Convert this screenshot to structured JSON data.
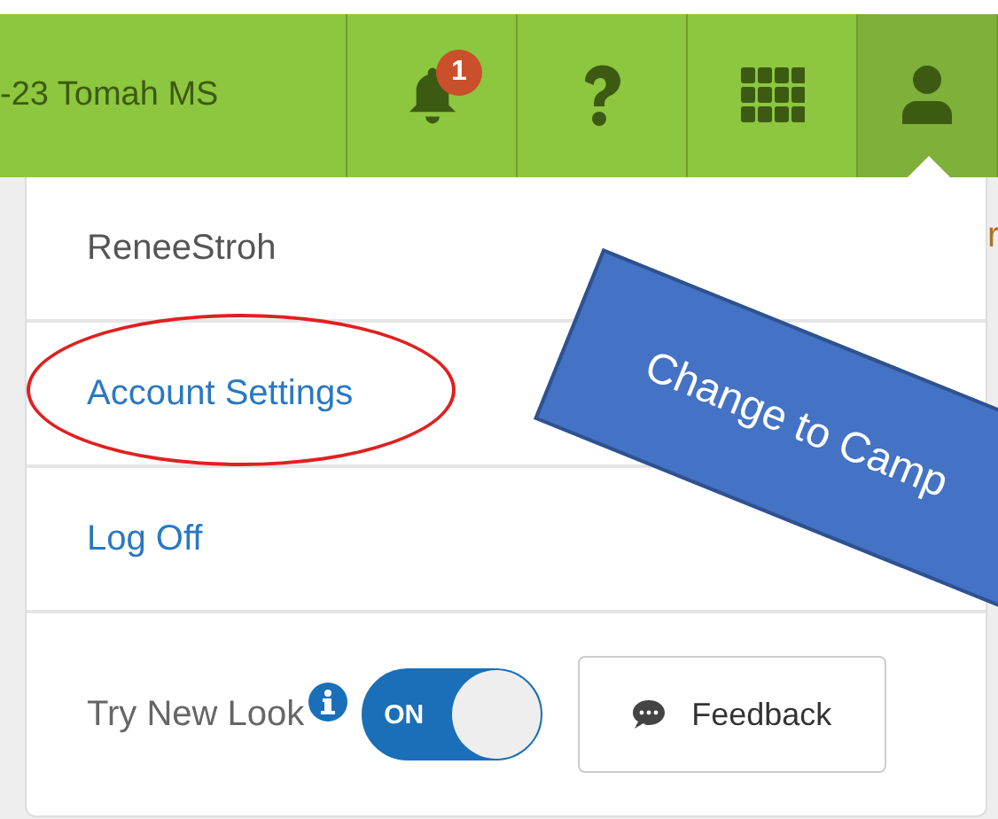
{
  "top_bar": {
    "school": "-23 Tomah MS",
    "notification_count": "1",
    "user_menu_open": true
  },
  "background_text": "r",
  "user_menu": {
    "items": [
      {
        "label": "ReneeStroh",
        "kind": "name"
      },
      {
        "label": "Account Settings",
        "kind": "link",
        "circled": true
      },
      {
        "label": "Log Off",
        "kind": "link",
        "circled": false
      }
    ],
    "try_new_look": {
      "label": "Try New Look",
      "toggle_label": "ON",
      "on": true
    },
    "feedback_button": "Feedback"
  },
  "callout": {
    "text": "Change to Camp"
  }
}
